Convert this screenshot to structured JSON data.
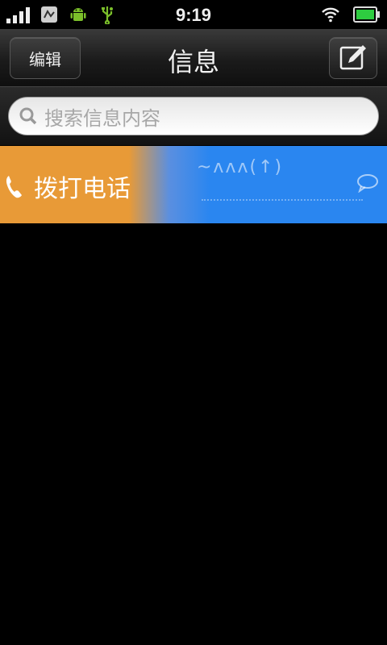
{
  "status_bar": {
    "time": "9:19",
    "icons": [
      "signal-icon",
      "notification-icon",
      "android-icon",
      "usb-icon",
      "wifi-icon",
      "battery-icon"
    ],
    "battery_color": "#2ecc40",
    "android_color": "#7bbf2a"
  },
  "nav": {
    "edit_label": "编辑",
    "title": "信息",
    "compose_icon": "compose-icon"
  },
  "search": {
    "placeholder": "搜索信息内容"
  },
  "swipe_row": {
    "action_label": "拨打电话",
    "action_color": "#e89a37",
    "row_color": "#2a86f0"
  }
}
